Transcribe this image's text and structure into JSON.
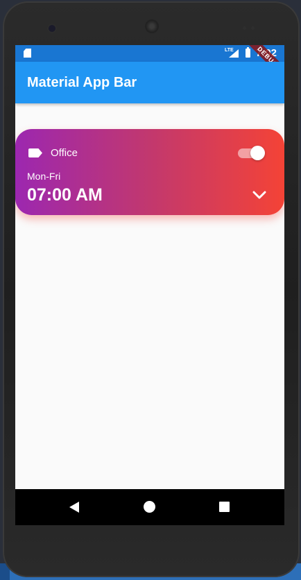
{
  "statusbar": {
    "network_label": "LTE",
    "clock": "7:02",
    "debug_banner": "DEBUG",
    "icons": [
      "sd-card-icon",
      "signal-icon",
      "battery-icon"
    ]
  },
  "appbar": {
    "title": "Material App Bar",
    "color": "#2196f3"
  },
  "alarm": {
    "label": "Office",
    "days": "Mon-Fri",
    "time": "07:00 AM",
    "enabled": true,
    "gradient_start": "#9c27b0",
    "gradient_end": "#f44336",
    "icons": [
      "label-icon",
      "chevron-down-icon"
    ]
  },
  "navbar": {
    "icons": [
      "back-icon",
      "home-icon",
      "recents-icon"
    ]
  }
}
